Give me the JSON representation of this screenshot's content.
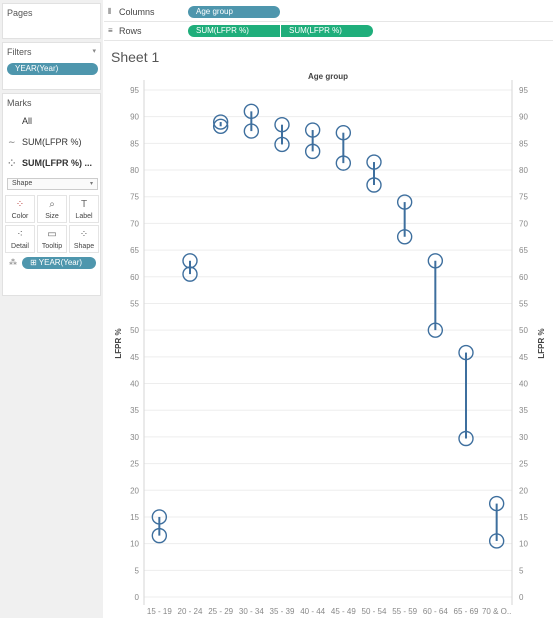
{
  "left": {
    "pages": {
      "title": "Pages"
    },
    "filters": {
      "title": "Filters",
      "caret": "▾",
      "pill": "YEAR(Year)"
    },
    "marks": {
      "title": "Marks",
      "items": [
        {
          "label": "All",
          "icon": ""
        },
        {
          "label": "SUM(LFPR %)",
          "icon": "∼"
        },
        {
          "label": "SUM(LFPR %) ...",
          "icon": "⁘"
        }
      ],
      "mark_type": "Shape",
      "mark_type_caret": "▾",
      "buttons": [
        {
          "label": "Color",
          "icon": "⁘"
        },
        {
          "label": "Size",
          "icon": "⌕"
        },
        {
          "label": "Label",
          "icon": "T"
        },
        {
          "label": "Detail",
          "icon": "⁖"
        },
        {
          "label": "Tooltip",
          "icon": "▭"
        },
        {
          "label": "Shape",
          "icon": "⁘"
        }
      ],
      "field_pill": "⊞ YEAR(Year)",
      "field_icon": "⁂"
    }
  },
  "shelves": {
    "columns": {
      "label": "Columns",
      "icon": "⦀",
      "pill": "Age group"
    },
    "rows": {
      "label": "Rows",
      "icon": "≡",
      "pills": [
        "SUM(LFPR %)",
        "SUM(LFPR %)"
      ]
    }
  },
  "sheet": {
    "title": "Sheet 1"
  },
  "colors": {
    "mark": "#3e6f9e",
    "grid": "#ededed",
    "axis_text": "#888888",
    "pill_blue": "#4e96ad",
    "pill_green": "#1fae7b"
  },
  "chart_data": {
    "type": "scatter",
    "title": "Age group",
    "xlabel": "Age group",
    "ylabel": "LFPR %",
    "ylabel_right": "LFPR %",
    "categories": [
      "15 - 19",
      "20 - 24",
      "25 - 29",
      "30 - 34",
      "35 - 39",
      "40 - 44",
      "45 - 49",
      "50 - 54",
      "55 - 59",
      "60 - 64",
      "65 - 69",
      "70 & O.."
    ],
    "ylim": [
      0,
      95
    ],
    "yticks": [
      0,
      5,
      10,
      15,
      20,
      25,
      30,
      35,
      40,
      45,
      50,
      55,
      60,
      65,
      70,
      75,
      80,
      85,
      90,
      95
    ],
    "series": [
      {
        "values": [
          15.0,
          63.0,
          89.0,
          91.0,
          88.5,
          87.5,
          87.0,
          81.5,
          74.0,
          63.0,
          45.8,
          17.5
        ]
      },
      {
        "values": [
          11.5,
          60.5,
          88.2,
          87.3,
          84.8,
          83.5,
          81.3,
          77.2,
          67.5,
          50.0,
          29.7,
          10.5
        ]
      }
    ],
    "grid": true,
    "dual_axis": true
  }
}
